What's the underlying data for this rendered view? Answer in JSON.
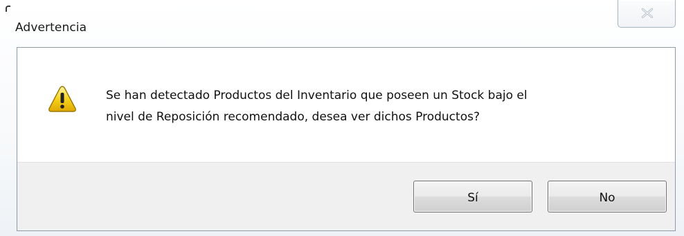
{
  "window": {
    "title": "Advertencia"
  },
  "dialog": {
    "icon": "warning-icon",
    "message_line1": "Se han detectado Productos del Inventario que poseen un Stock bajo el",
    "message_line2": "nivel de Reposición recomendado, desea ver dichos Productos?"
  },
  "buttons": {
    "yes_label": "Sí",
    "no_label": "No"
  },
  "colors": {
    "footer_bg": "#f0f0f0",
    "warning_yellow": "#f2c200",
    "border": "#8e9aa8"
  }
}
